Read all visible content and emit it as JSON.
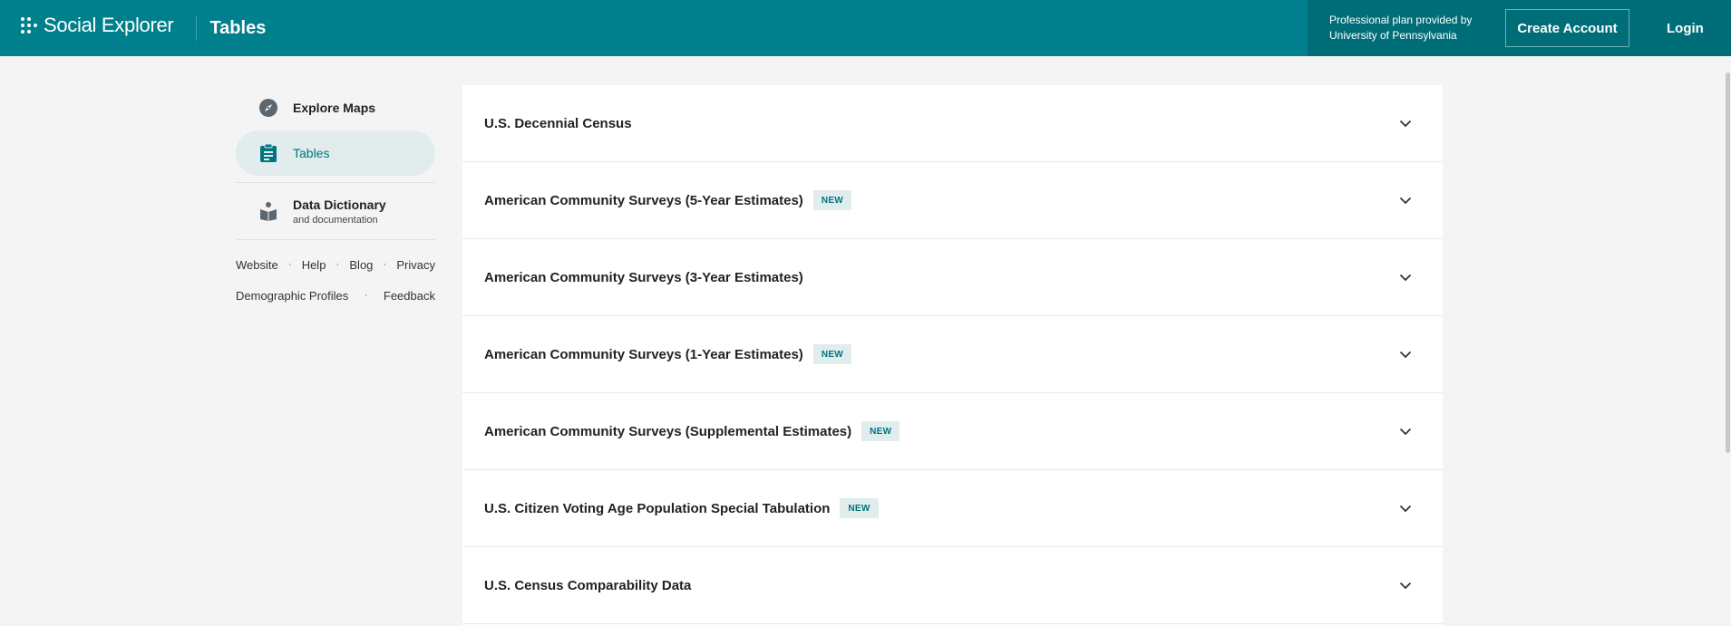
{
  "header": {
    "logo_text": "Social Explorer",
    "page_title": "Tables",
    "plan_line1": "Professional plan provided by",
    "plan_line2": "University of Pennsylvania",
    "create_account": "Create Account",
    "login": "Login"
  },
  "sidebar": {
    "items": [
      {
        "label": "Explore Maps",
        "icon": "compass-icon"
      },
      {
        "label": "Tables",
        "icon": "clipboard-icon"
      }
    ],
    "dictionary": {
      "title": "Data Dictionary",
      "subtitle": "and documentation",
      "icon": "book-reader-icon"
    },
    "links_row1": [
      "Website",
      "Help",
      "Blog",
      "Privacy"
    ],
    "links_row2": [
      "Demographic Profiles",
      "Feedback"
    ]
  },
  "datasets": [
    {
      "title": "U.S. Decennial Census",
      "badge": ""
    },
    {
      "title": "American Community Surveys (5-Year Estimates)",
      "badge": "NEW"
    },
    {
      "title": "American Community Surveys (3-Year Estimates)",
      "badge": ""
    },
    {
      "title": "American Community Surveys (1-Year Estimates)",
      "badge": "NEW"
    },
    {
      "title": "American Community Surveys (Supplemental Estimates)",
      "badge": "NEW"
    },
    {
      "title": "U.S. Citizen Voting Age Population Special Tabulation",
      "badge": "NEW"
    },
    {
      "title": "U.S. Census Comparability Data",
      "badge": ""
    }
  ],
  "colors": {
    "brand": "#007f8c",
    "brand_dark": "#006e79",
    "accent_bg": "#e1eced",
    "accent_text": "#00747f"
  }
}
